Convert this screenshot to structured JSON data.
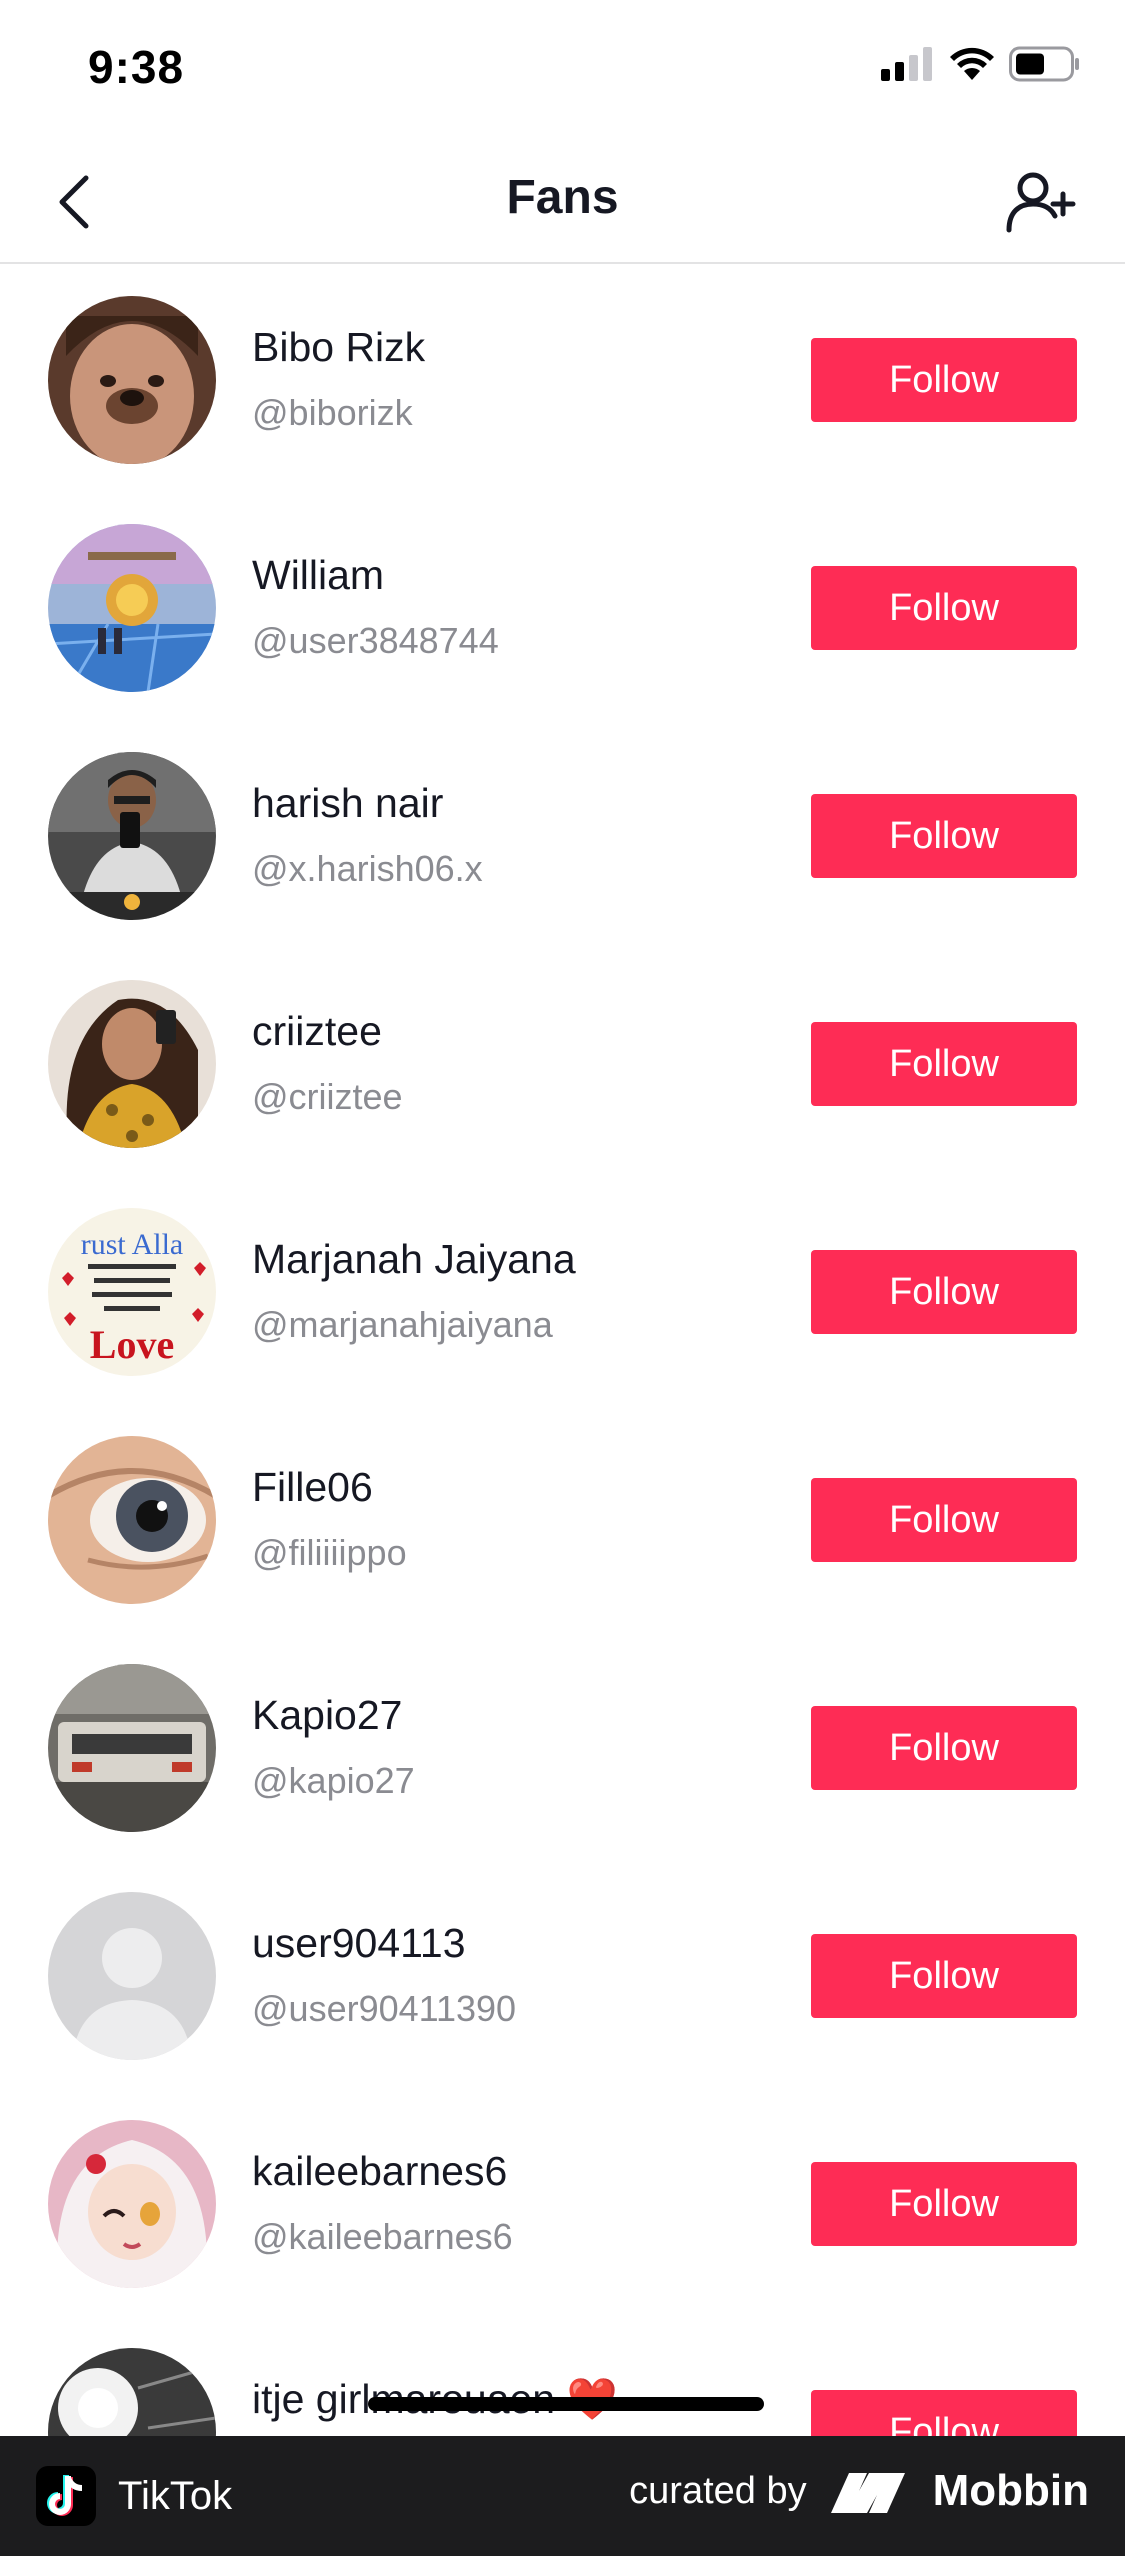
{
  "status_bar": {
    "time": "9:38"
  },
  "nav": {
    "title": "Fans"
  },
  "fans": [
    {
      "name": "Bibo Rizk",
      "handle": "@biborizk",
      "button": "Follow"
    },
    {
      "name": "William",
      "handle": "@user3848744",
      "button": "Follow"
    },
    {
      "name": "harish nair",
      "handle": "@x.harish06.x",
      "button": "Follow"
    },
    {
      "name": "criiztee",
      "handle": "@criiztee",
      "button": "Follow"
    },
    {
      "name": "Marjanah Jaiyana",
      "handle": "@marjanahjaiyana",
      "button": "Follow",
      "avatar_text": "rust Alla"
    },
    {
      "name": "Fille06",
      "handle": "@filiiiippo",
      "button": "Follow"
    },
    {
      "name": "Kapio27",
      "handle": "@kapio27",
      "button": "Follow"
    },
    {
      "name": "user904113",
      "handle": "@user90411390",
      "button": "Follow"
    },
    {
      "name": "kaileebarnes6",
      "handle": "@kaileebarnes6",
      "button": "Follow"
    },
    {
      "name": "itje girlmarouaen ❤️",
      "handle": "",
      "button": "Follow"
    }
  ],
  "footer": {
    "app_name": "TikTok",
    "curated_by": "curated by",
    "brand": "Mobbin"
  },
  "colors": {
    "accent": "#fe2c55",
    "footer_bg": "#1c1c1e"
  }
}
